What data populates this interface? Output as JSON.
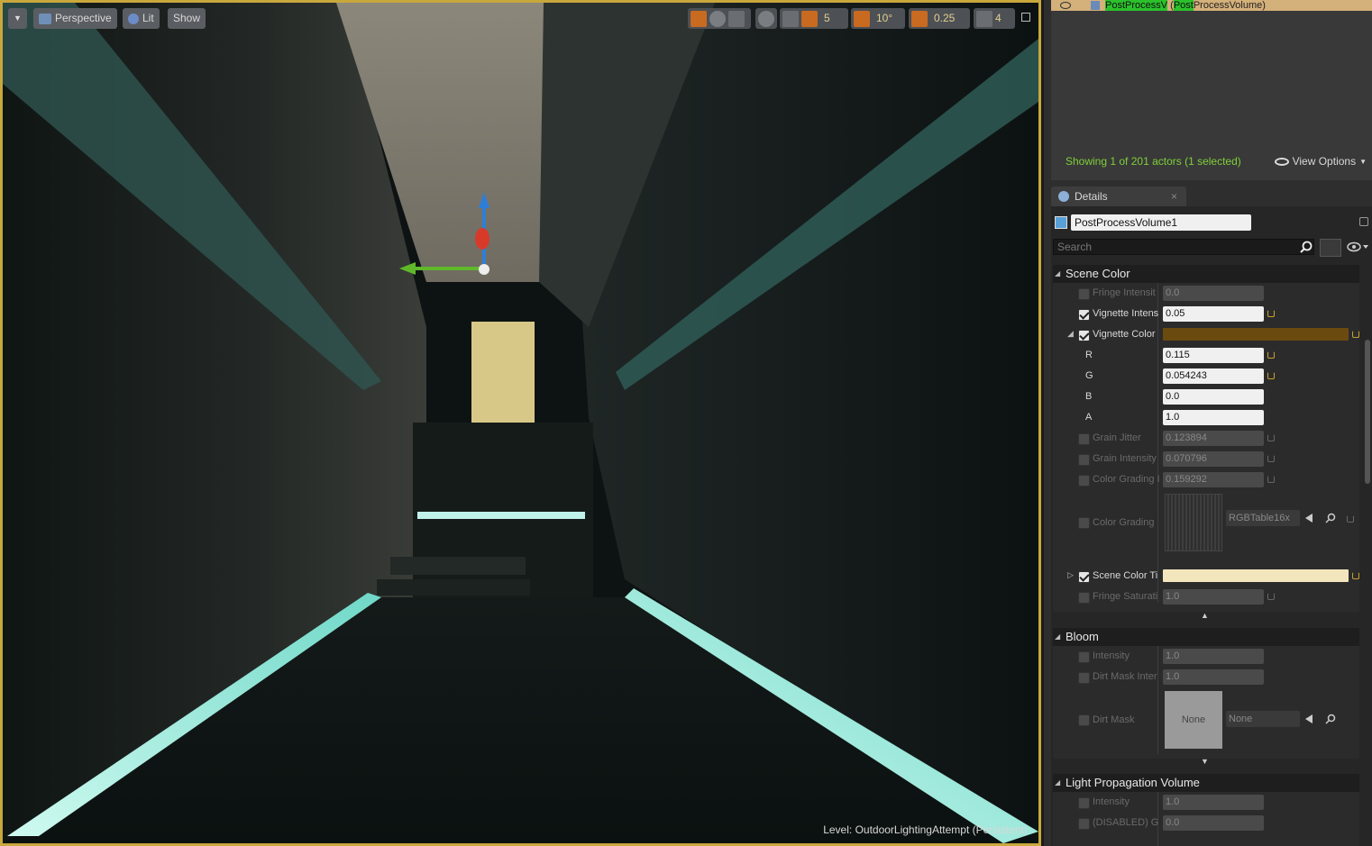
{
  "viewport": {
    "dropdown_label": "",
    "view_mode": "Perspective",
    "lighting_mode": "Lit",
    "show_label": "Show",
    "grid_snap": "5",
    "rotation_snap": "10°",
    "scale_snap": "0.25",
    "camera_speed": "4",
    "level_label": "Level:",
    "level_name": "OutdoorLightingAttempt (Persistent)"
  },
  "outliner": {
    "row_hl1": "PostProcessV",
    "row_mid": " (",
    "row_hl2": "Post",
    "row_rest": "ProcessVolume)",
    "status": "Showing 1 of 201 actors (1 selected)",
    "view_options": "View Options"
  },
  "details": {
    "tab_label": "Details",
    "tab_close": "×",
    "actor_name": "PostProcessVolume1",
    "search_placeholder": "Search",
    "scene_color": {
      "header": "Scene Color",
      "rows": [
        {
          "label": "Fringe Intensit",
          "value": "0.0"
        },
        {
          "label": "Vignette Intens",
          "value": "0.05"
        },
        {
          "label": "Vignette Color",
          "value": ""
        },
        {
          "label": "R",
          "value": "0.115"
        },
        {
          "label": "G",
          "value": "0.054243"
        },
        {
          "label": "B",
          "value": "0.0"
        },
        {
          "label": "A",
          "value": "1.0"
        },
        {
          "label": "Grain Jitter",
          "value": "0.123894"
        },
        {
          "label": "Grain Intensity",
          "value": "0.070796"
        },
        {
          "label": "Color Grading I",
          "value": "0.159292"
        },
        {
          "label": "Color Grading",
          "value": "RGBTable16x"
        },
        {
          "label": "Scene Color Ti",
          "value": ""
        },
        {
          "label": "Fringe Saturati",
          "value": "1.0"
        }
      ]
    },
    "bloom": {
      "header": "Bloom",
      "rows": [
        {
          "label": "Intensity",
          "value": "1.0"
        },
        {
          "label": "Dirt Mask Inter",
          "value": "1.0"
        },
        {
          "label": "Dirt Mask",
          "value": "None",
          "thumb": "None"
        }
      ]
    },
    "lpv": {
      "header": "Light Propagation Volume",
      "rows": [
        {
          "label": "Intensity",
          "value": "1.0"
        },
        {
          "label": "(DISABLED) Gr",
          "value": "0.0"
        }
      ]
    }
  },
  "colors": {
    "viewport_border": "#c8a83c",
    "vignette_color": "#6b4a10",
    "scene_tint": "#f3e6bd",
    "selection_highlight": "#2bc12b",
    "status_green": "#7fcf3a"
  }
}
